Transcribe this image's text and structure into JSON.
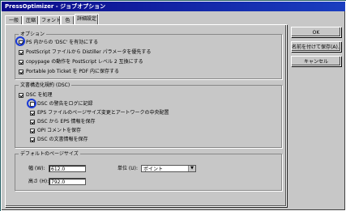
{
  "window": {
    "title": "PressOptimizer - ジョブオプション"
  },
  "tabs": [
    {
      "label": "一般"
    },
    {
      "label": "圧縮"
    },
    {
      "label": "フォント"
    },
    {
      "label": "色"
    },
    {
      "label": "詳細設定"
    }
  ],
  "options_group": {
    "label": "オプション",
    "items": [
      {
        "label": "PS 内からの 'DSC' を有効にする",
        "checked": true
      },
      {
        "label": "PostScript ファイルから Distiller パラメータを優先する",
        "checked": true
      },
      {
        "label": "copypage の動作を PostScript レベル 2 互換にする",
        "checked": true
      },
      {
        "label": "Portable Job Ticket を PDF 内に保存する",
        "checked": true
      }
    ]
  },
  "dsc_group": {
    "label": "文書構造化規約 (DSC)",
    "items": [
      {
        "label": "DSC を処理",
        "checked": true
      },
      {
        "label": "DSC の警告をログに記録",
        "checked": false
      },
      {
        "label": "EPS ファイルのページサイズ変更とアートワークの中央配置",
        "checked": true
      },
      {
        "label": "DSC から EPS 情報を保存",
        "checked": true
      },
      {
        "label": "OPI コメントを保存",
        "checked": true
      },
      {
        "label": "DSC の文書情報を保存",
        "checked": true
      }
    ]
  },
  "page_size_group": {
    "label": "デフォルトのページサイズ",
    "width_label": "幅 (W):",
    "width_value": "612.0",
    "height_label": "高さ (H):",
    "height_value": "792.0",
    "unit_label": "単位 (U):",
    "unit_value": "ポイント"
  },
  "buttons": {
    "ok": "OK",
    "save_as": "名前を付けて保存(A)...",
    "cancel": "キャンセル"
  },
  "accent_colors": {
    "titlebar": "#0a0a8a",
    "ring": "#1b3bd6"
  }
}
